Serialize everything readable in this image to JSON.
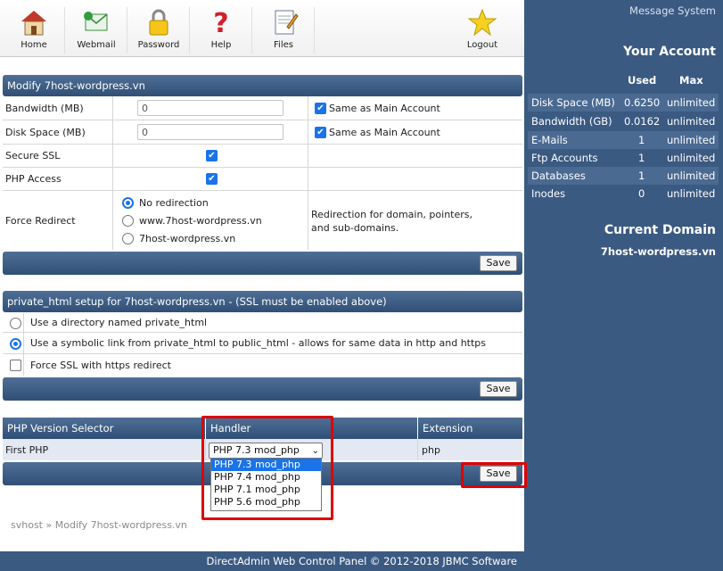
{
  "toolbar": {
    "items": [
      {
        "label": "Home",
        "icon": "home-icon"
      },
      {
        "label": "Webmail",
        "icon": "mail-icon"
      },
      {
        "label": "Password",
        "icon": "lock-icon"
      },
      {
        "label": "Help",
        "icon": "question-icon"
      },
      {
        "label": "Files",
        "icon": "files-icon"
      },
      {
        "label": "Logout",
        "icon": "star-icon"
      }
    ]
  },
  "modify": {
    "title": "Modify 7host-wordpress.vn",
    "bandwidth": {
      "label": "Bandwidth (MB)",
      "value": "0",
      "same_label": "Same as Main Account",
      "same_checked": true
    },
    "disk": {
      "label": "Disk Space (MB)",
      "value": "0",
      "same_label": "Same as Main Account",
      "same_checked": true
    },
    "ssl": {
      "label": "Secure SSL",
      "checked": true
    },
    "php": {
      "label": "PHP Access",
      "checked": true
    },
    "redirect": {
      "label": "Force Redirect",
      "options": [
        "No redirection",
        "www.7host-wordpress.vn",
        "7host-wordpress.vn"
      ],
      "selected": 0,
      "note_line1": "Redirection for domain, pointers,",
      "note_line2": "and sub-domains."
    },
    "save_label": "Save"
  },
  "private_html": {
    "title": "private_html setup for 7host-wordpress.vn - (SSL must be enabled above)",
    "options": [
      "Use a directory named private_html",
      "Use a symbolic link from private_html to public_html - allows for same data in http and https"
    ],
    "selected": 1,
    "force_ssl_label": "Force SSL with https redirect",
    "force_ssl_checked": false,
    "save_label": "Save"
  },
  "php_selector": {
    "headers": [
      "PHP Version Selector",
      "Handler",
      "Extension"
    ],
    "row": {
      "name": "First PHP",
      "handler": "PHP 7.3 mod_php",
      "extension": "php"
    },
    "dropdown_options": [
      "PHP 7.3 mod_php",
      "PHP 7.4 mod_php",
      "PHP 7.1 mod_php",
      "PHP 5.6 mod_php"
    ],
    "dropdown_selected": 0,
    "save_label": "Save"
  },
  "breadcrumb": {
    "root": "svhost",
    "separator": "»",
    "current": "Modify 7host-wordpress.vn"
  },
  "sidebar": {
    "message_system": "Message System",
    "account_title": "Your Account",
    "col_used": "Used",
    "col_max": "Max",
    "stats": [
      {
        "label": "Disk Space (MB)",
        "used": "0.6250",
        "max": "unlimited"
      },
      {
        "label": "Bandwidth (GB)",
        "used": "0.0162",
        "max": "unlimited"
      },
      {
        "label": "E-Mails",
        "used": "1",
        "max": "unlimited"
      },
      {
        "label": "Ftp Accounts",
        "used": "1",
        "max": "unlimited"
      },
      {
        "label": "Databases",
        "used": "1",
        "max": "unlimited"
      },
      {
        "label": "Inodes",
        "used": "0",
        "max": "unlimited"
      }
    ],
    "current_domain_title": "Current Domain",
    "current_domain": "7host-wordpress.vn"
  },
  "footer": "DirectAdmin Web Control Panel © 2012-2018 JBMC Software",
  "colors": {
    "header": "#3b5a82",
    "accent": "#1a73e8",
    "highlight": "#e00000"
  }
}
